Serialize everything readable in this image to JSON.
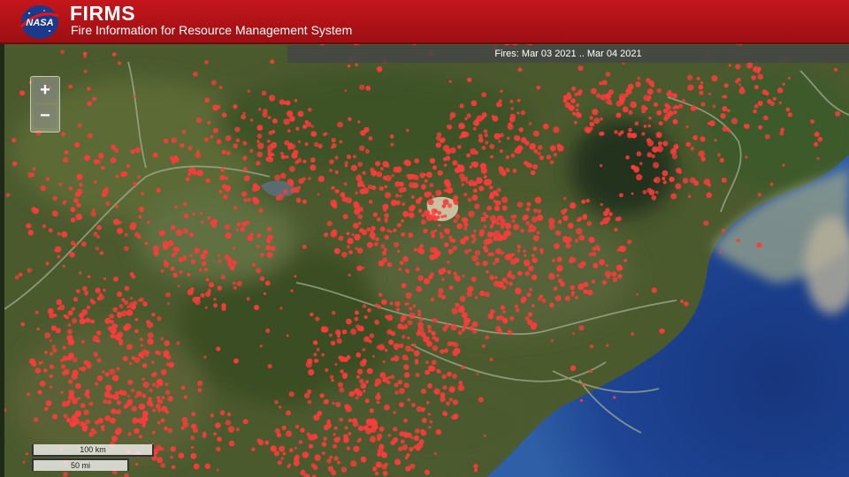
{
  "header": {
    "title": "FIRMS",
    "subtitle": "Fire Information for Resource Management System",
    "logo_text": "NASA",
    "color": "#b3141a"
  },
  "map": {
    "fires_label": "Fires: Mar 03 2021 .. Mar 04 2021",
    "fire_color": "#ff3b3b",
    "land_color": "#4a5a2c",
    "ocean_color": "#1d3f8a"
  },
  "zoom": {
    "in_label": "+",
    "out_label": "−"
  },
  "scale": {
    "km_label": "100 km",
    "mi_label": "50 mi"
  }
}
